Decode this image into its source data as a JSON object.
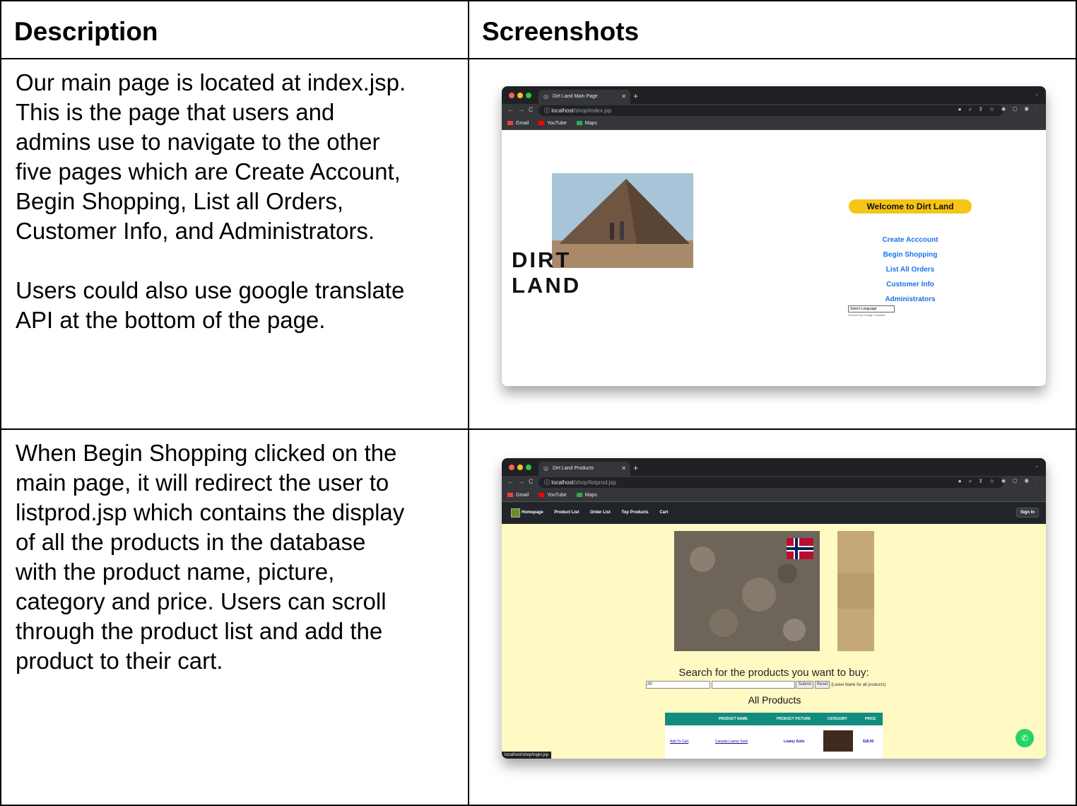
{
  "headers": {
    "description": "Description",
    "screenshots": "Screenshots"
  },
  "rows": [
    {
      "description": "Our main page is located at index.jsp.\nThis is the page that users and\nadmins use to navigate to the other\nfive pages which are Create Account,\nBegin Shopping, List all Orders,\nCustomer Info, and Administrators.\n\nUsers could also use google translate\nAPI at the bottom of the page.",
      "browser": {
        "tab_title": "Dirt Land Main Page",
        "url_host": "localhost",
        "url_path": "/shop/index.jsp",
        "bookmarks": [
          "Gmail",
          "YouTube",
          "Maps"
        ],
        "page": {
          "title_line1": "DIRT",
          "title_line2": "LAND",
          "welcome": "Welcome to Dirt Land",
          "links": [
            "Create Acccount",
            "Begin Shopping",
            "List All Orders",
            "Customer Info",
            "Administrators"
          ],
          "select_language": "Select Language",
          "powered_by": "Powered by Google Translate"
        }
      }
    },
    {
      "description": "When Begin Shopping clicked on the\nmain page, it will redirect the user to\nlistprod.jsp which contains the display\nof all the products in the database\nwith the product name, picture,\ncategory and price. Users can scroll\nthrough the product list and add the\nproduct to their cart.",
      "browser": {
        "tab_title": "Dirt Land Products",
        "url_host": "localhost",
        "url_path": "/shop/listprod.jsp",
        "bookmarks": [
          "Gmail",
          "YouTube",
          "Maps"
        ],
        "nav": [
          "Homepage",
          "Product List",
          "Order List",
          "Top Products",
          "Cart"
        ],
        "sign_in": "Sign In",
        "search_label": "Search for the products you want to buy:",
        "category_selected": "All",
        "submit": "Submit",
        "reset": "Reset",
        "hint": "(Leave blank for all products)",
        "all_products": "All Products",
        "columns": [
          "PRODUCT NAME",
          "PRODUCT PICTURE",
          "CATEGORY",
          "PRICE"
        ],
        "product_row": {
          "add": "Add To Cart",
          "name": "Canada Loamy Soils",
          "category": "Loamy Soils",
          "price": "$18.00"
        },
        "status_url": "localhost/shop/login.jsp"
      }
    }
  ]
}
